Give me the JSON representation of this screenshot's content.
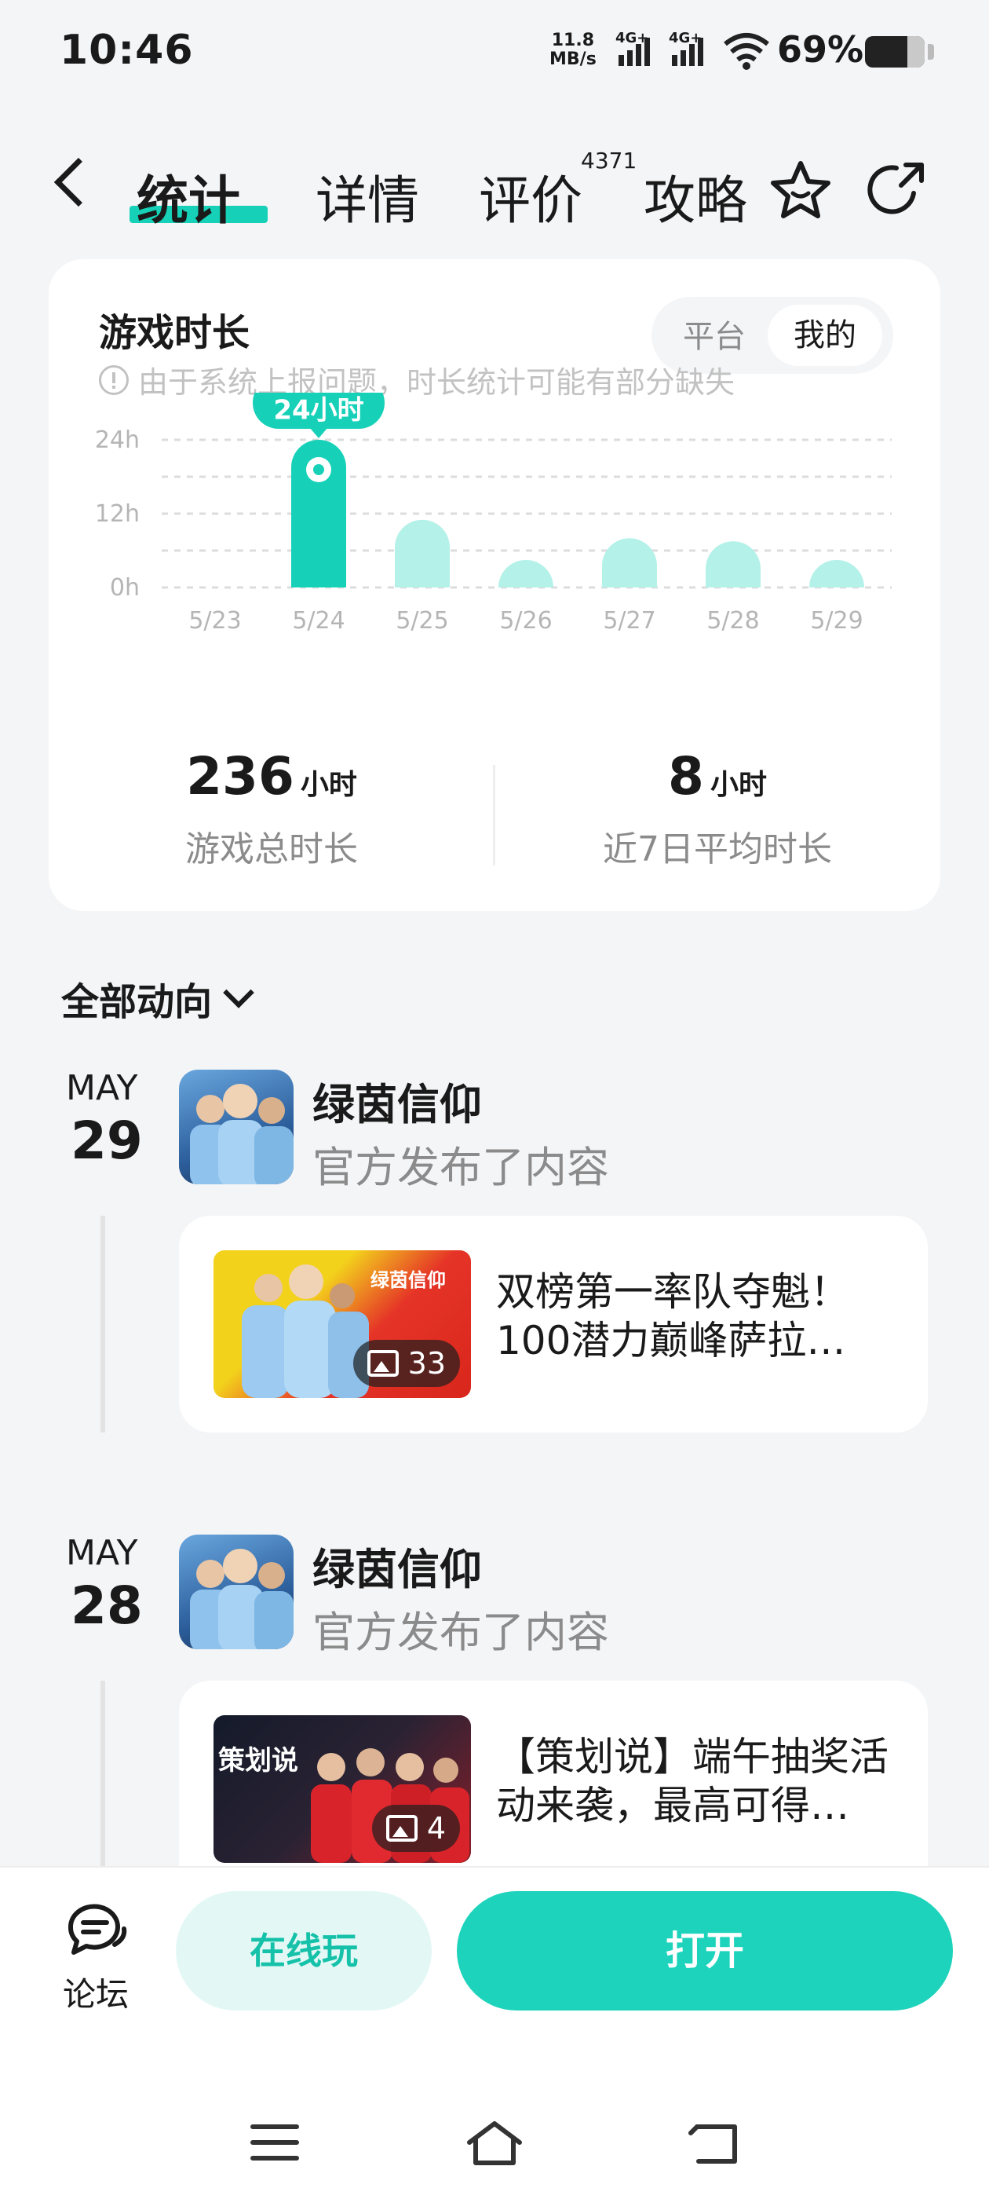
{
  "status_bar": {
    "time": "10:46",
    "net_speed_value": "11.8",
    "net_speed_unit": "MB/s",
    "sim1_label": "4G+",
    "sim2_label": "4G+",
    "battery_percent": "69%"
  },
  "nav": {
    "tabs": [
      {
        "label": "统计",
        "active": true
      },
      {
        "label": "详情",
        "active": false
      },
      {
        "label": "评价",
        "active": false
      },
      {
        "label": "攻略",
        "active": false
      }
    ],
    "review_count": "4371",
    "icons": [
      "back-icon",
      "star-icon",
      "share-icon"
    ]
  },
  "stats_card": {
    "title": "游戏时长",
    "toggle": {
      "options": [
        "平台",
        "我的"
      ],
      "selected": "我的"
    },
    "notice": "由于系统上报问题，时长统计可能有部分缺失",
    "summary": [
      {
        "value": "236",
        "unit": "小时",
        "label": "游戏总时长"
      },
      {
        "value": "8",
        "unit": "小时",
        "label": "近7日平均时长"
      }
    ]
  },
  "chart_data": {
    "type": "bar",
    "categories": [
      "5/23",
      "5/24",
      "5/25",
      "5/26",
      "5/27",
      "5/28",
      "5/29"
    ],
    "values": [
      0,
      24,
      11,
      3.5,
      8,
      7.5,
      2
    ],
    "y_ticks": [
      "0h",
      "12h",
      "24h"
    ],
    "ylim": [
      0,
      24
    ],
    "highlight_index": 1,
    "tooltip": "24小时",
    "colors": {
      "highlight": "#16d1b8",
      "normal": "#b3f1e9",
      "grid": "#dcdcdc"
    }
  },
  "feed": {
    "filter_label": "全部动向",
    "entries": [
      {
        "month": "MAY",
        "day": "29",
        "author": "绿茵信仰",
        "action": "官方发布了内容",
        "post_title_line1": "双榜第一率队夺魁！",
        "post_title_line2": "100潜力巅峰萨拉…",
        "image_count": "33",
        "thumb_text": "绿茵信仰"
      },
      {
        "month": "MAY",
        "day": "28",
        "author": "绿茵信仰",
        "action": "官方发布了内容",
        "post_title_line1": "【策划说】端午抽奖活",
        "post_title_line2": "动来袭，最高可得…",
        "image_count": "4",
        "thumb_text": "策划说"
      }
    ]
  },
  "bottom_bar": {
    "forum_label": "论坛",
    "online_play_label": "在线玩",
    "open_label": "打开"
  },
  "system_nav": [
    "menu-icon",
    "home-icon",
    "back-nav-icon"
  ]
}
